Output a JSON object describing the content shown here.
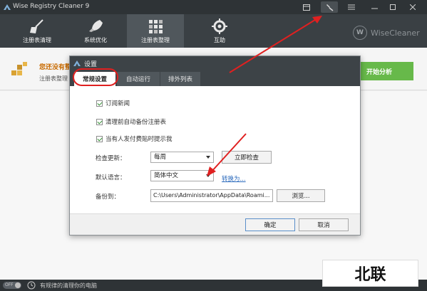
{
  "window": {
    "title": "Wise Registry Cleaner 9"
  },
  "toolbar": {
    "items": [
      {
        "label": "注册表清理",
        "icon": "broom-icon"
      },
      {
        "label": "系统优化",
        "icon": "rocket-icon"
      },
      {
        "label": "注册表整理",
        "icon": "grid-icon"
      },
      {
        "label": "互助",
        "icon": "gear-icon"
      }
    ],
    "brand_letter": "W",
    "brand": "WiseCleaner"
  },
  "banner": {
    "title": "您还没有整",
    "subtitle": "注册表整理",
    "analyze_button": "开始分析"
  },
  "dialog": {
    "title": "设置",
    "tabs": [
      "常规设置",
      "自动运行",
      "排外列表"
    ],
    "checkboxes": [
      {
        "label": "订阅新闻",
        "checked": true
      },
      {
        "label": "清理前自动备份注册表",
        "checked": true
      },
      {
        "label": "当有人发付费贴时提示我",
        "checked": true
      }
    ],
    "check_update": {
      "label": "检查更新：",
      "value": "每周",
      "button": "立即检查"
    },
    "language": {
      "label": "默认语言：",
      "value": "简体中文",
      "link": "转换为..."
    },
    "backup": {
      "label": "备份到：",
      "path": "C:\\Users\\Administrator\\AppData\\Roami...",
      "browse": "浏览..."
    },
    "ok": "确定",
    "cancel": "取消"
  },
  "statusbar": {
    "toggle": "OFF",
    "text": "有规律的清理你的电脑"
  },
  "watermark": "北联",
  "colors": {
    "accent_green": "#67b94a",
    "annotation_red": "#e02020",
    "dark_bar": "#2e3336"
  }
}
